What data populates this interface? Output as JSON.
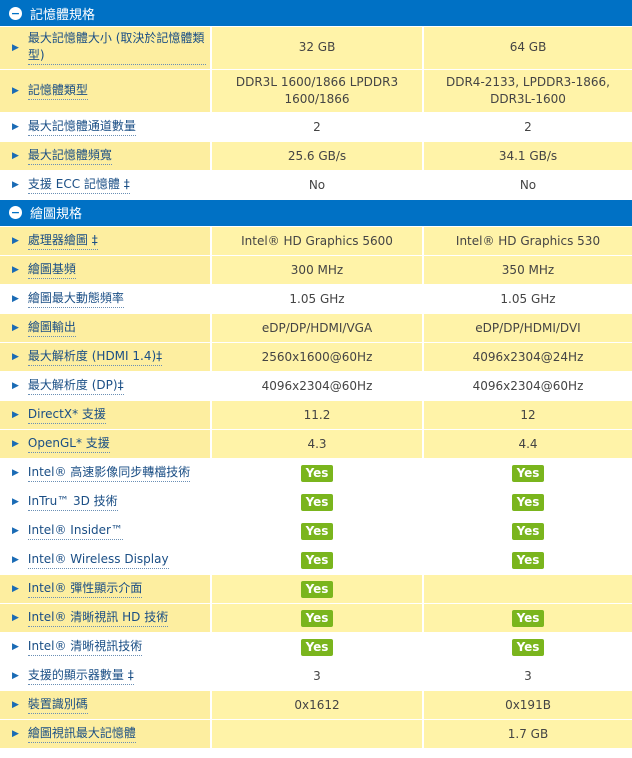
{
  "sections": [
    {
      "title": "記憶體規格",
      "rows": [
        {
          "label": "最大記憶體大小 (取決於記憶體類型)",
          "col1": "32 GB",
          "col2": "64 GB",
          "h": 42
        },
        {
          "label": "記憶體類型",
          "col1": "DDR3L 1600/1866 LPDDR3 1600/1866",
          "col2": "DDR4-2133, LPDDR3-1866, DDR3L-1600",
          "h": 43
        },
        {
          "label": "最大記憶體通道數量",
          "col1": "2",
          "col2": "2",
          "h": 29
        },
        {
          "label": "最大記憶體頻寬",
          "col1": "25.6 GB/s",
          "col2": "34.1 GB/s",
          "h": 29
        },
        {
          "label": "支援 ECC 記憶體 ‡",
          "col1": "No",
          "col2": "No",
          "h": 29
        }
      ]
    },
    {
      "title": "繪圖規格",
      "rows": [
        {
          "label": "處理器繪圖 ‡",
          "col1": "Intel® HD Graphics 5600",
          "col2": "Intel® HD Graphics 530",
          "h": 29
        },
        {
          "label": "繪圖基頻",
          "col1": "300 MHz",
          "col2": "350 MHz",
          "h": 29
        },
        {
          "label": "繪圖最大動態頻率",
          "col1": "1.05 GHz",
          "col2": "1.05 GHz",
          "h": 29
        },
        {
          "label": "繪圖輸出",
          "col1": "eDP/DP/HDMI/VGA",
          "col2": "eDP/DP/HDMI/DVI",
          "h": 29
        },
        {
          "label": "最大解析度 (HDMI 1.4)‡",
          "col1": "2560x1600@60Hz",
          "col2": "4096x2304@24Hz",
          "h": 29
        },
        {
          "label": "最大解析度 (DP)‡",
          "col1": "4096x2304@60Hz",
          "col2": "4096x2304@60Hz",
          "h": 29
        },
        {
          "label": "DirectX* 支援",
          "col1": "11.2",
          "col2": "12",
          "h": 29
        },
        {
          "label": "OpenGL* 支援",
          "col1": "4.3",
          "col2": "4.4",
          "h": 29
        },
        {
          "label": "Intel® 高速影像同步轉檔技術",
          "col1": "Yes",
          "col2": "Yes",
          "h": 29
        },
        {
          "label": "InTru™ 3D 技術",
          "col1": "Yes",
          "col2": "Yes",
          "h": 29
        },
        {
          "label": "Intel® Insider™",
          "col1": "Yes",
          "col2": "Yes",
          "h": 29
        },
        {
          "label": "Intel® Wireless Display",
          "col1": "Yes",
          "col2": "Yes",
          "h": 29
        },
        {
          "label": "Intel® 彈性顯示介面",
          "col1": "Yes",
          "col2": "",
          "h": 29
        },
        {
          "label": "Intel® 清晰視訊 HD 技術",
          "col1": "Yes",
          "col2": "Yes",
          "h": 29
        },
        {
          "label": "Intel® 清晰視訊技術",
          "col1": "Yes",
          "col2": "Yes",
          "h": 29
        },
        {
          "label": "支援的顯示器數量 ‡",
          "col1": "3",
          "col2": "3",
          "h": 29
        },
        {
          "label": "裝置識別碼",
          "col1": "0x1612",
          "col2": "0x191B",
          "h": 29
        },
        {
          "label": "繪圖視訊最大記憶體",
          "col1": "",
          "col2": "1.7 GB",
          "h": 29
        }
      ]
    }
  ],
  "colors": {
    "header": "#0071c5",
    "yellow": "#fff3a8",
    "yes": "#7ab51d",
    "label": "#1a4e85"
  },
  "icons": {
    "section": "minus-circle-icon",
    "row": "triangle-right-icon"
  }
}
